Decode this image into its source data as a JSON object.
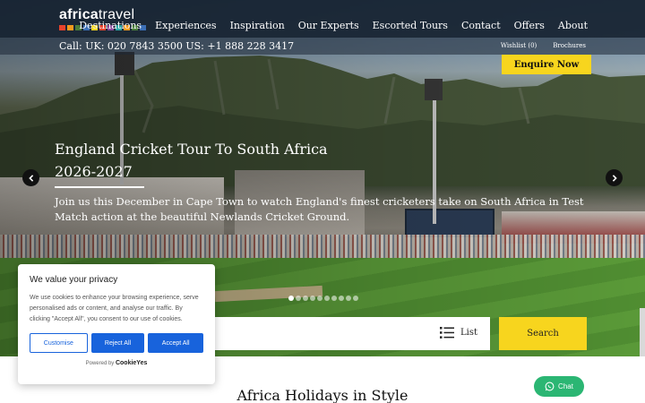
{
  "brand": {
    "logo_text_left": "africa",
    "logo_text_right": "travel",
    "logo_colors": [
      "#e8432c",
      "#f39a1e",
      "#4a7d3a",
      "#3b6fb6",
      "#f7d51e",
      "#e8432c",
      "#8a4a9a",
      "#2aa6a6",
      "#f39a1e",
      "#4a7d3a",
      "#3b6fb6"
    ]
  },
  "nav": {
    "items": [
      "Destinations",
      "Experiences",
      "Inspiration",
      "Our Experts",
      "Escorted Tours",
      "Contact",
      "Offers",
      "About"
    ]
  },
  "subbar": {
    "phones": "Call: UK: 020 7843 3500   US: +1 888 228 3417",
    "wishlist": "Wishlist (0)",
    "brochures": "Brochures"
  },
  "enquire_label": "Enquire Now",
  "hero": {
    "title": "England Cricket Tour To South Africa 2026-2027",
    "description": "Join us this December in Cape Town to watch England's finest cricketers take on South Africa in Test Match action at the beautiful Newlands Cricket Ground.",
    "slide_count": 10,
    "active_slide": 1
  },
  "search": {
    "list_label": "List",
    "button_label": "Search"
  },
  "section_heading": "Africa Holidays in Style",
  "chat_label": "Chat",
  "cookie": {
    "title": "We value your privacy",
    "text": "We use cookies to enhance your browsing experience, serve personalised ads or content, and analyse our traffic. By clicking \"Accept All\", you consent to our use of cookies.",
    "customise": "Customise",
    "reject": "Reject All",
    "accept": "Accept All",
    "powered_prefix": "Powered by",
    "powered_brand": "CookieYes"
  },
  "colors": {
    "accent_yellow": "#f7d51e",
    "nav_bg": "#162230",
    "cookie_blue": "#1863dc",
    "chat_green": "#2bb673"
  }
}
